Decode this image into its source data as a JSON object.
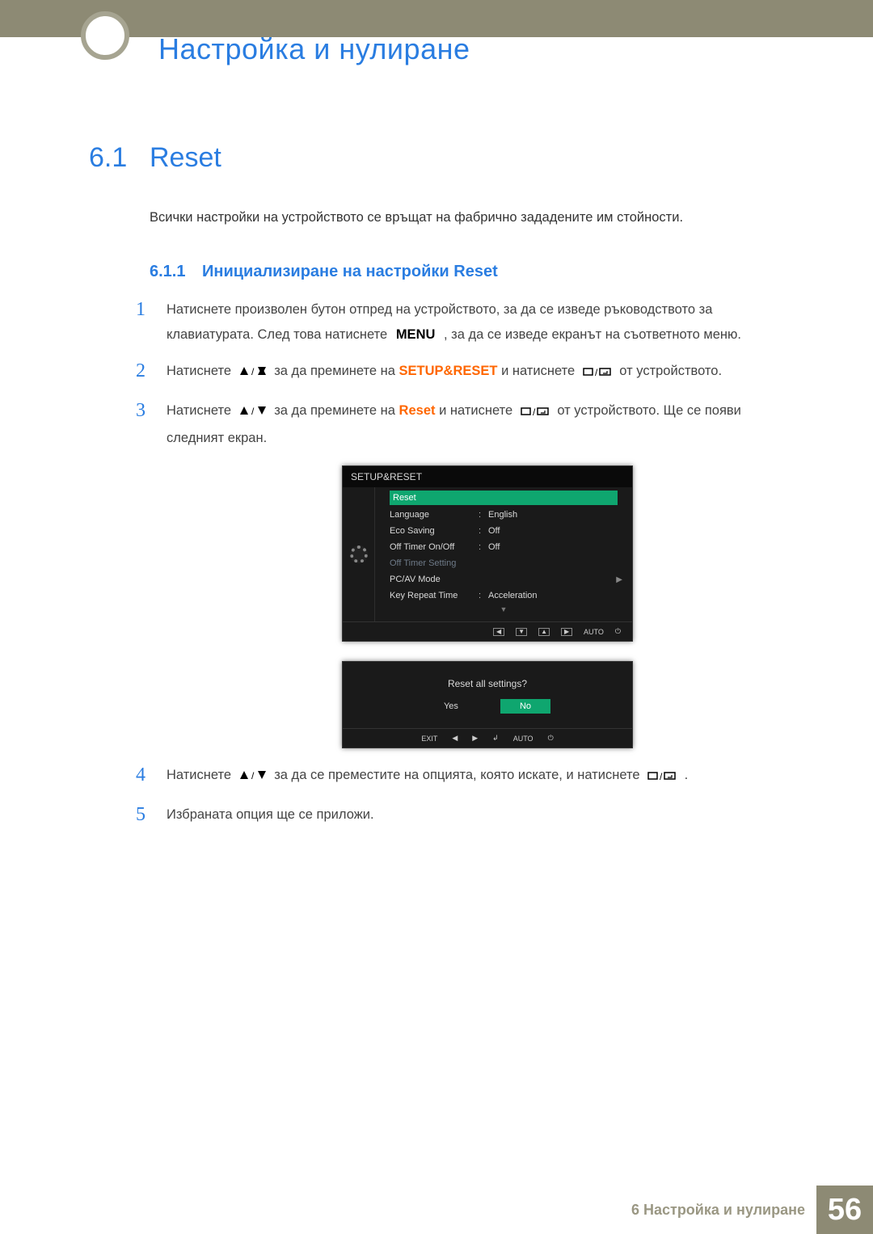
{
  "chapter_title": "Настройка и нулиране",
  "section": {
    "num": "6.1",
    "title": "Reset"
  },
  "intro_text": "Всички настройки на устройството се връщат на фабрично зададените им стойности.",
  "subsection": {
    "num": "6.1.1",
    "title": "Инициализиране на настройки Reset"
  },
  "steps": {
    "s1": {
      "num": "1",
      "text_a": "Натиснете произволен бутон отпред на устройството, за да се изведе ръководството за клавиатурата. След това натиснете ",
      "menu": "MENU",
      "text_b": ", за да се изведе екранът на съответното меню."
    },
    "s2": {
      "num": "2",
      "text_a": "Натиснете ",
      "nav": "за да преминете на ",
      "target": "SETUP&RESET",
      "text_b": " и натиснете ",
      "text_c": " от устройството."
    },
    "s3": {
      "num": "3",
      "text_a": "Натиснете ",
      "nav": "за да преминете на ",
      "target": "Reset",
      "text_b": " и натиснете ",
      "text_c": " от устройството. Ще се появи следният екран."
    },
    "s4": {
      "num": "4",
      "text_a": "Натиснете ",
      "nav": "за да се преместите на опцията, която искате, и натиснете ",
      "text_c": "."
    },
    "s5": {
      "num": "5",
      "text": "Избраната опция ще се приложи."
    }
  },
  "osd1": {
    "title": "SETUP&RESET",
    "rows": {
      "reset": "Reset",
      "language": {
        "label": "Language",
        "value": "English"
      },
      "eco": {
        "label": "Eco Saving",
        "value": "Off"
      },
      "offtimer": {
        "label": "Off Timer On/Off",
        "value": "Off"
      },
      "offtimer_setting": {
        "label": "Off Timer Setting"
      },
      "pcav": {
        "label": "PC/AV Mode"
      },
      "keyrepeat": {
        "label": "Key Repeat Time",
        "value": "Acceleration"
      }
    },
    "nav_auto": "AUTO"
  },
  "osd2": {
    "question": "Reset all settings?",
    "yes": "Yes",
    "no": "No",
    "exit": "EXIT",
    "auto": "AUTO"
  },
  "footer": {
    "chapter_label": "6 Настройка и нулиране",
    "page_num": "56"
  }
}
